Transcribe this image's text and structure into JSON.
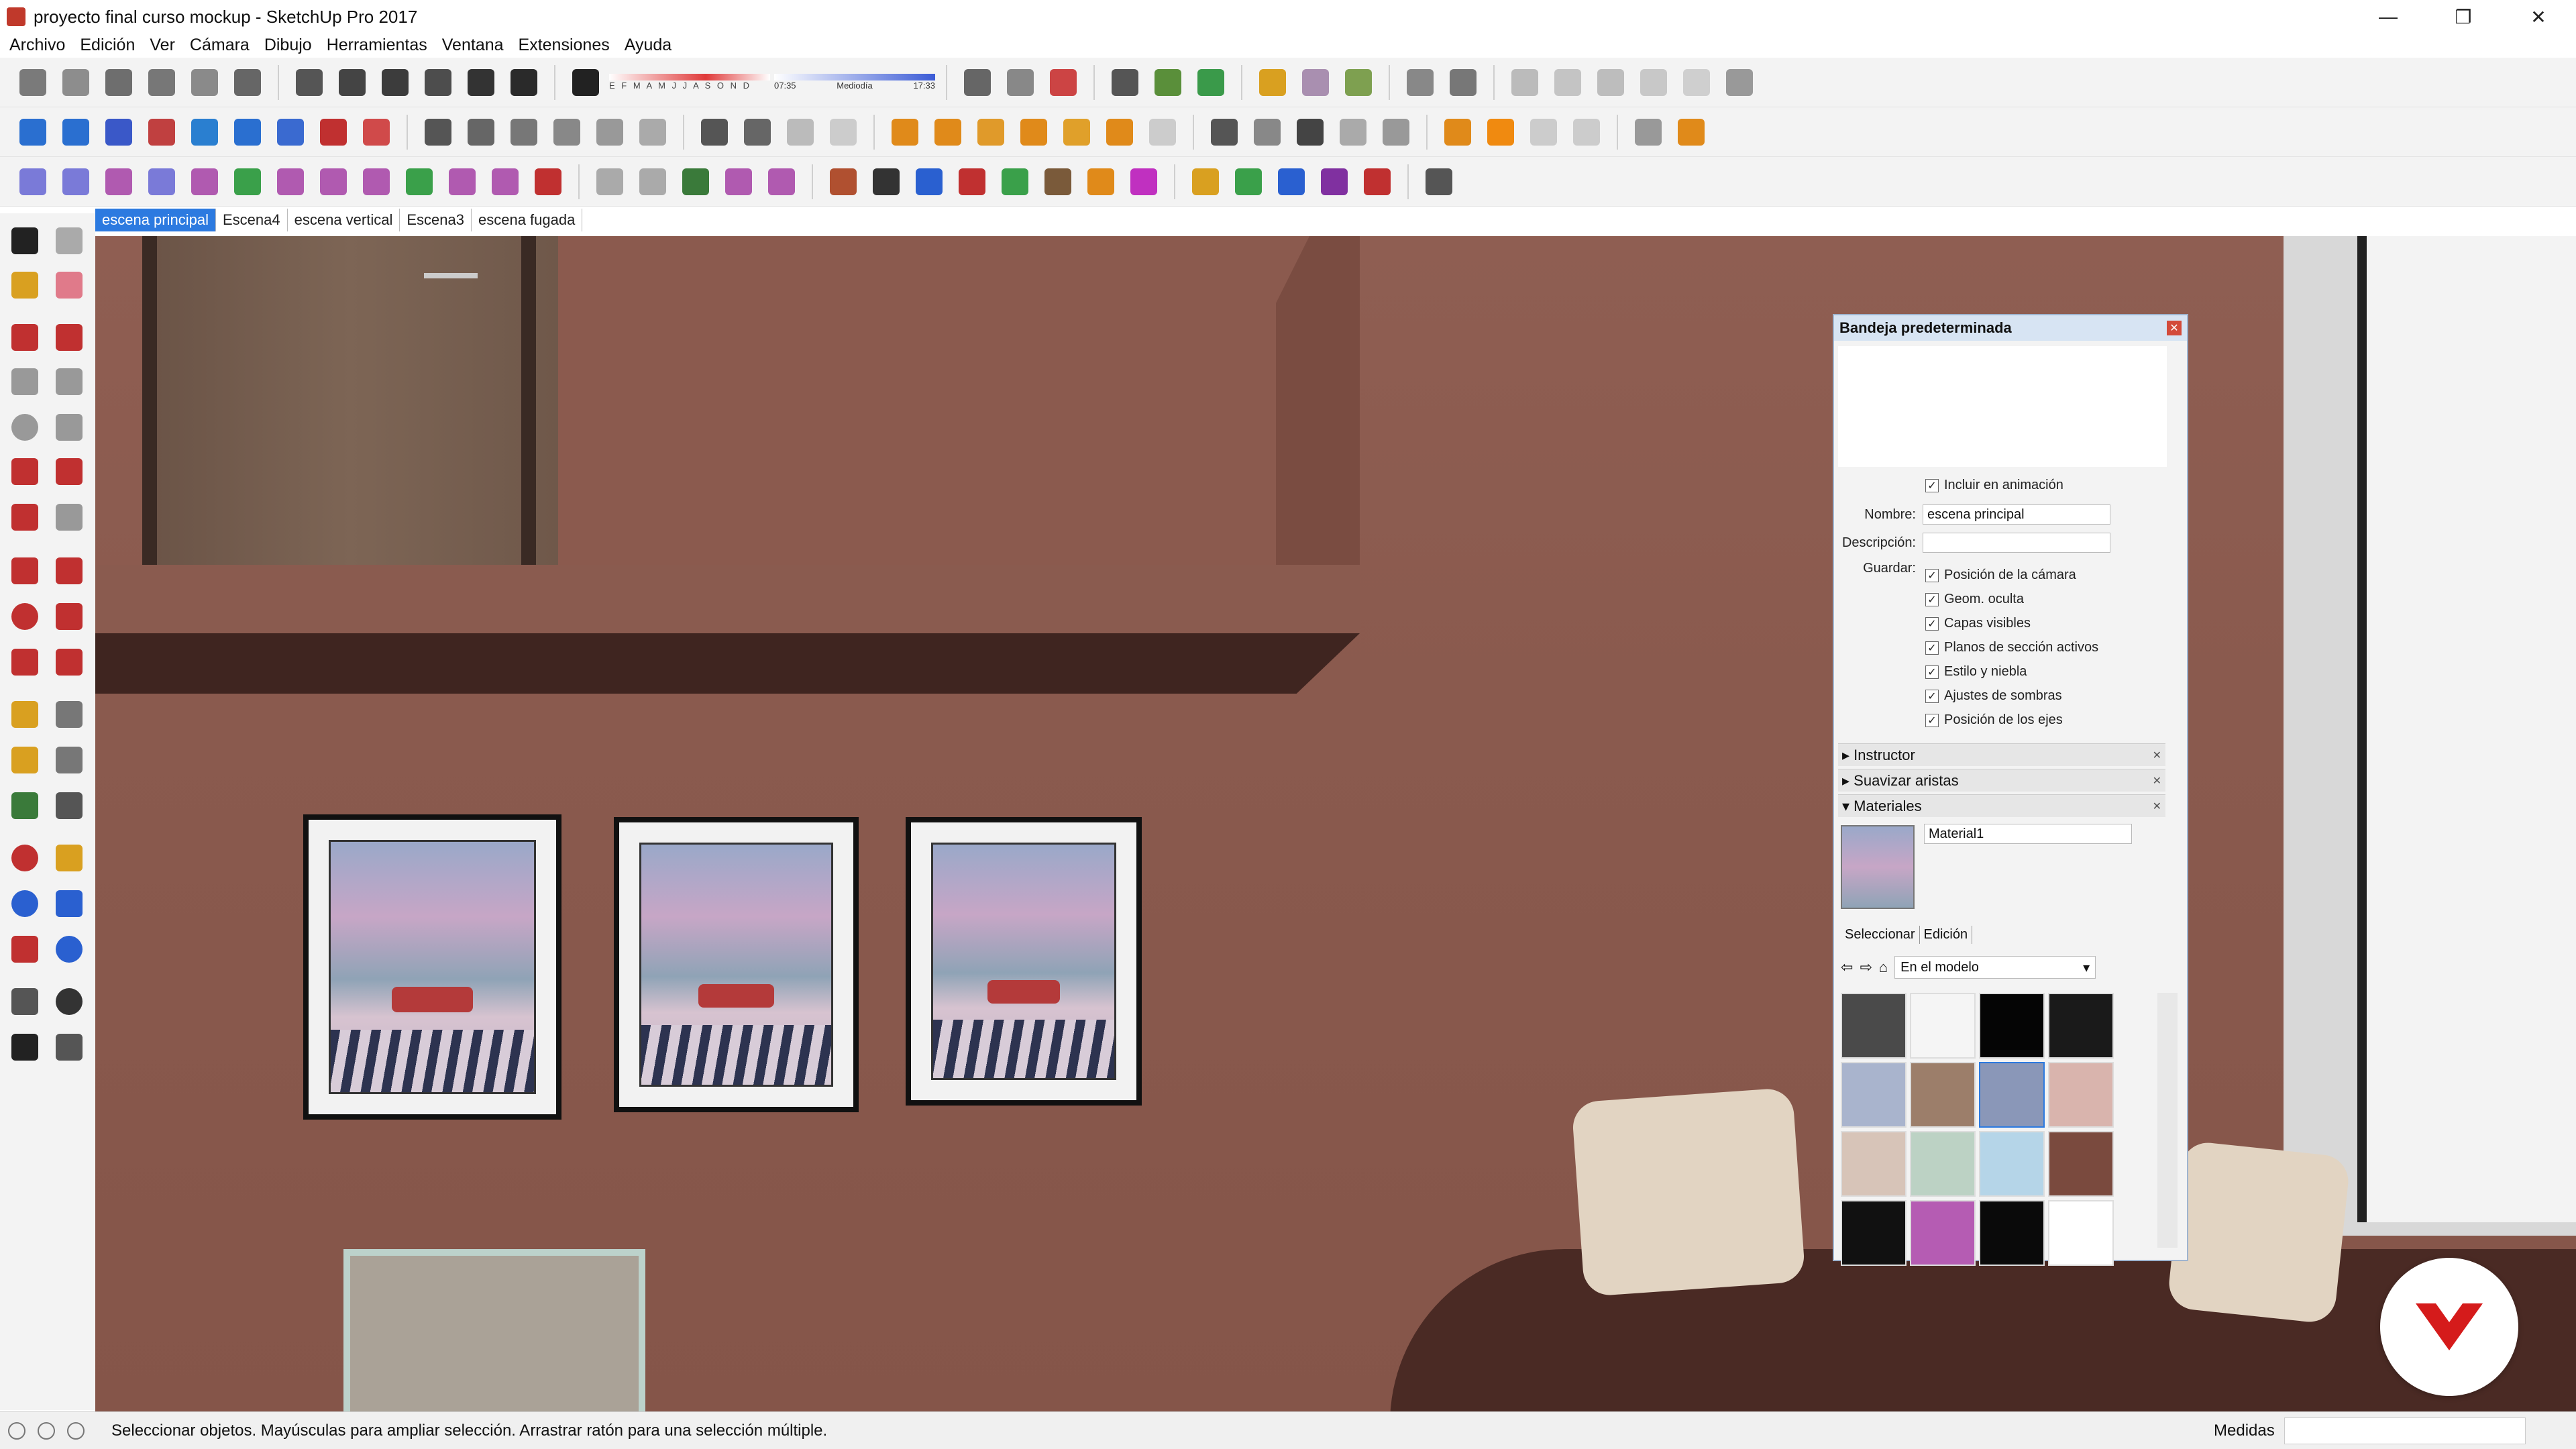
{
  "window": {
    "title": "proyecto final curso mockup - SketchUp Pro 2017",
    "controls": [
      "—",
      "❐",
      "✕"
    ]
  },
  "menu": [
    "Archivo",
    "Edición",
    "Ver",
    "Cámara",
    "Dibujo",
    "Herramientas",
    "Ventana",
    "Extensiones",
    "Ayuda"
  ],
  "shadow_settings": {
    "months": "E F M A M J J A S O N D",
    "time_start": "07:35",
    "time_mid": "Mediodía",
    "time_end": "17:33"
  },
  "scene_tabs": [
    {
      "label": "escena principal",
      "active": true
    },
    {
      "label": "Escena4",
      "active": false
    },
    {
      "label": "escena vertical",
      "active": false
    },
    {
      "label": "Escena3",
      "active": false
    },
    {
      "label": "escena fugada",
      "active": false
    }
  ],
  "tray": {
    "title": "Bandeja predeterminada",
    "include_animation": "Incluir en animación",
    "name_label": "Nombre:",
    "name_value": "escena principal",
    "description_label": "Descripción:",
    "description_value": "",
    "save_label": "Guardar:",
    "save_options": [
      "Posición de la cámara",
      "Geom. oculta",
      "Capas visibles",
      "Planos de sección activos",
      "Estilo y niebla",
      "Ajustes de sombras",
      "Posición de los ejes"
    ],
    "sections": [
      {
        "label": "Instructor",
        "expanded": false
      },
      {
        "label": "Suavizar aristas",
        "expanded": false
      },
      {
        "label": "Materiales",
        "expanded": true
      }
    ],
    "materials": {
      "current_name": "Material1",
      "tabs": [
        "Seleccionar",
        "Edición"
      ],
      "collection": "En el modelo",
      "swatches": [
        "#4a4a4a",
        "#f5f5f5",
        "#050505",
        "#1a1a1a",
        "#a9b4cd",
        "#9c7e6a",
        "#8a97b8",
        "#d9b4ad",
        "#d7c4b8",
        "#bcd2c4",
        "#b5d5e8",
        "#7a4a3e",
        "#111111",
        "#b55cb3",
        "#0a0a0a",
        "#ffffff"
      ]
    }
  },
  "status": {
    "hint": "Seleccionar objetos. Mayúsculas para ampliar selección. Arrastrar ratón para una selección múltiple.",
    "measures_label": "Medidas",
    "measures_value": ""
  }
}
